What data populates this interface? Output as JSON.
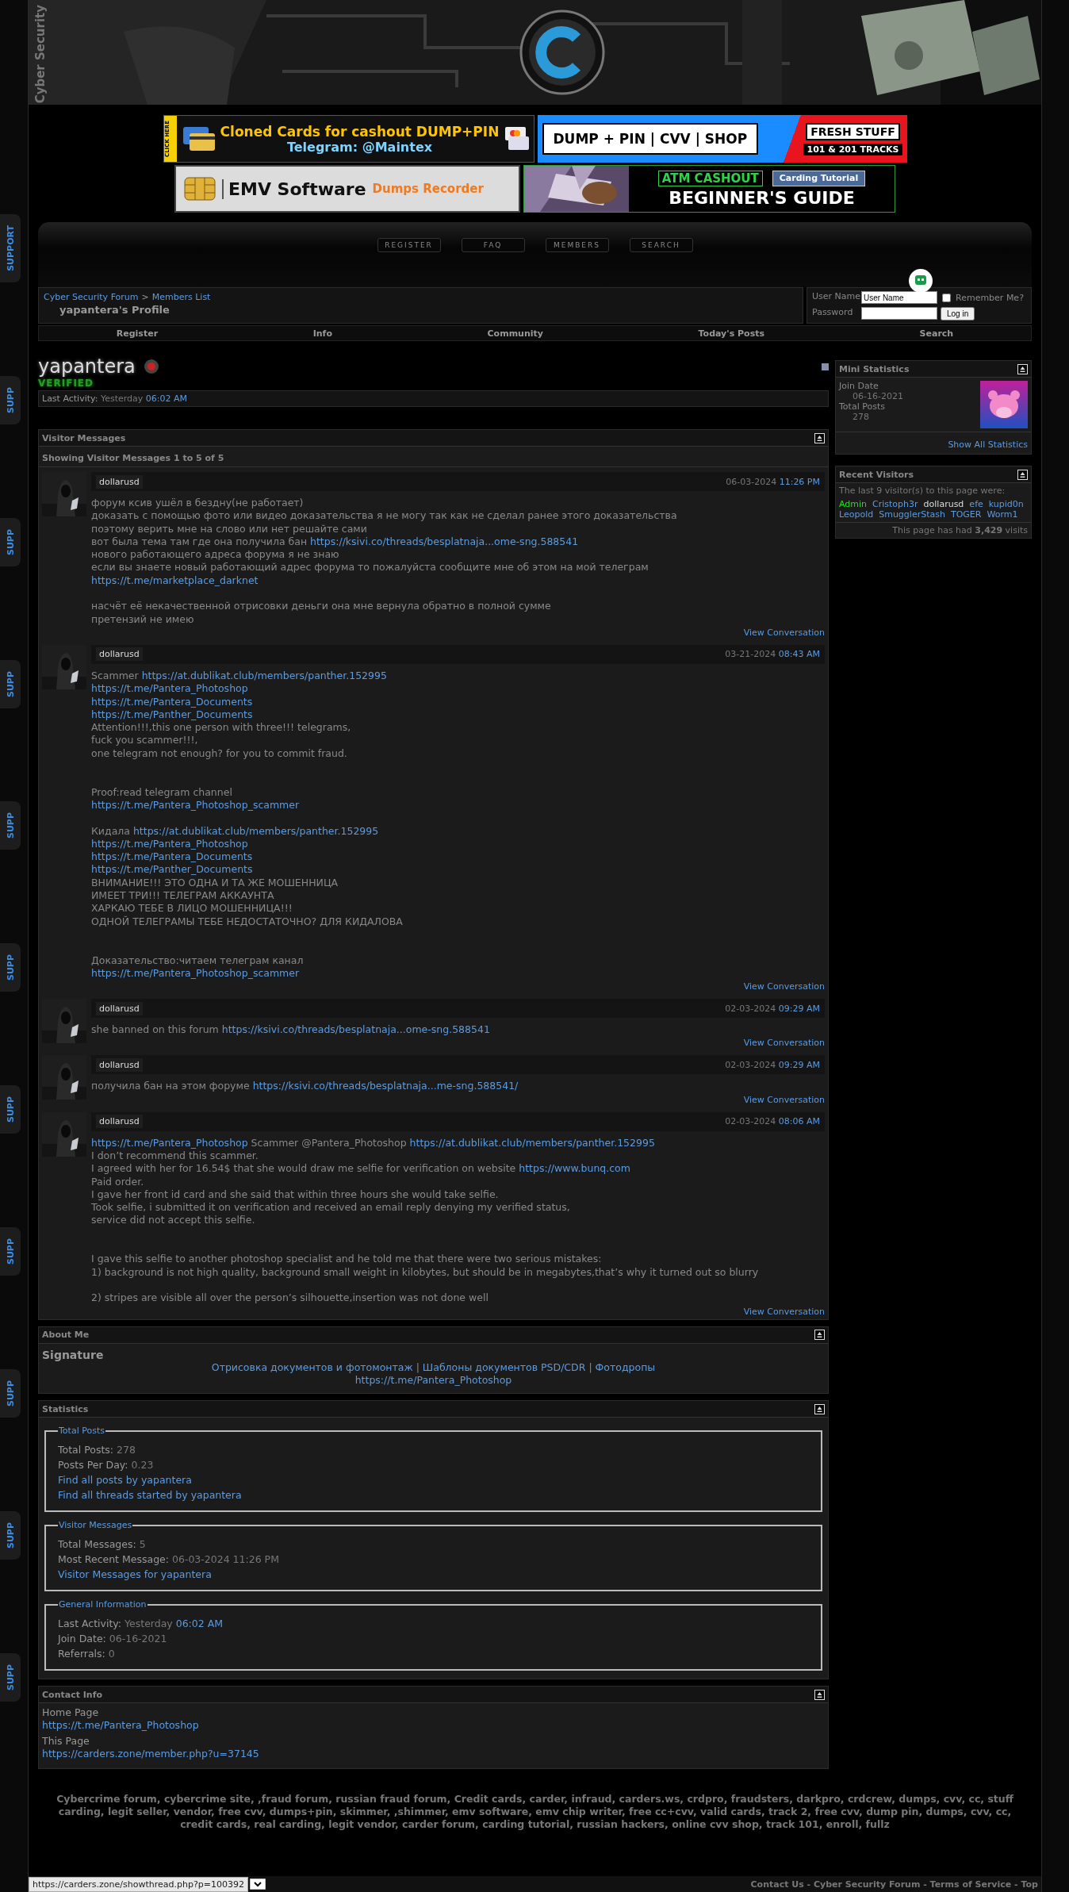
{
  "header": {
    "site_title": "Cyber Security"
  },
  "ad_rows": [
    [
      {
        "kind": "cards",
        "tag": "CLICK HERE",
        "title": "Cloned Cards for cashout DUMP+PIN",
        "contact": "Telegram: @Maintex"
      },
      {
        "kind": "shop",
        "title": "DUMP + PIN | CVV | SHOP",
        "badge": "FRESH STUFF",
        "sub": "101 & 201 TRACKS"
      }
    ],
    [
      {
        "kind": "software",
        "title": "EMV Software",
        "sub": "Dumps Recorder"
      },
      {
        "kind": "tutorial",
        "badge": "ATM CASHOUT",
        "tag": "Carding Tutorial",
        "title": "BEGINNER'S GUIDE"
      }
    ]
  ],
  "nav_buttons": [
    "REGISTER",
    "FAQ",
    "MEMBERS",
    "SEARCH"
  ],
  "breadcrumb": {
    "links": [
      "Cyber Security Forum",
      "Members List"
    ],
    "separator": ">",
    "current": "yapantera's Profile"
  },
  "login": {
    "username_label": "User Name",
    "username_value": "User Name",
    "remember_label": "Remember Me?",
    "remember_checked": false,
    "password_label": "Password",
    "button": "Log in"
  },
  "navbar": [
    "Register",
    "Info",
    "Community",
    "Today's Posts",
    "Search"
  ],
  "profile": {
    "username": "yapantera",
    "online": false,
    "rank": "VERIFIED",
    "last_activity_label": "Last Activity:",
    "last_activity_day": "Yesterday",
    "last_activity_time": "06:02 AM"
  },
  "visitor_messages": {
    "title": "Visitor Messages",
    "subtitle": "Showing Visitor Messages 1 to 5 of 5",
    "messages": [
      {
        "author": "dollarusd",
        "date": "06-03-2024",
        "time": "11:26 PM",
        "action": "View Conversation",
        "lines": [
          {
            "kind": "text",
            "parts": [
              {
                "kind": "plain",
                "text": "форум ксив ушёл в бездну(не работает)"
              }
            ]
          },
          {
            "kind": "text",
            "parts": [
              {
                "kind": "plain",
                "text": "доказать с помощью фото или видео доказательства я не могу так как не сделал ранее этого доказательства"
              }
            ]
          },
          {
            "kind": "text",
            "parts": [
              {
                "kind": "plain",
                "text": "поэтому верить мне на слово или нет решайте сами"
              }
            ]
          },
          {
            "kind": "text",
            "parts": [
              {
                "kind": "plain",
                "text": "вот была тема там где она получила бан "
              },
              {
                "kind": "link",
                "text": "https://ksivi.co/threads/besplatnaja...ome-sng.588541"
              }
            ]
          },
          {
            "kind": "text",
            "parts": [
              {
                "kind": "plain",
                "text": "нового работающего адреса форума я не знаю"
              }
            ]
          },
          {
            "kind": "text",
            "parts": [
              {
                "kind": "plain",
                "text": "если вы знаете новый работающий адрес форума то пожалуйста сообщите мне об этом на мой телеграм"
              }
            ]
          },
          {
            "kind": "text",
            "parts": [
              {
                "kind": "link",
                "text": "https://t.me/marketplace_darknet"
              }
            ]
          },
          {
            "kind": "blank"
          },
          {
            "kind": "text",
            "parts": [
              {
                "kind": "plain",
                "text": "насчёт её некачественной отрисовки деньги она мне вернула обратно в полной сумме"
              }
            ]
          },
          {
            "kind": "text",
            "parts": [
              {
                "kind": "plain",
                "text": "претензий не имею"
              }
            ]
          }
        ]
      },
      {
        "author": "dollarusd",
        "date": "03-21-2024",
        "time": "08:43 AM",
        "action": "View Conversation",
        "lines": [
          {
            "kind": "text",
            "parts": [
              {
                "kind": "plain",
                "text": "Scammer "
              },
              {
                "kind": "link",
                "text": "https://at.dublikat.club/members/panther.152995"
              }
            ]
          },
          {
            "kind": "text",
            "parts": [
              {
                "kind": "link",
                "text": "https://t.me/Pantera_Photoshop"
              }
            ]
          },
          {
            "kind": "text",
            "parts": [
              {
                "kind": "link",
                "text": "https://t.me/Pantera_Documents"
              }
            ]
          },
          {
            "kind": "text",
            "parts": [
              {
                "kind": "link",
                "text": "https://t.me/Panther_Documents"
              }
            ]
          },
          {
            "kind": "text",
            "parts": [
              {
                "kind": "plain",
                "text": "Attention!!!,this one person with three!!! telegrams,"
              }
            ]
          },
          {
            "kind": "text",
            "parts": [
              {
                "kind": "plain",
                "text": "fuck you scammer!!!,"
              }
            ]
          },
          {
            "kind": "text",
            "parts": [
              {
                "kind": "plain",
                "text": "one telegram not enough? for you to commit fraud."
              }
            ]
          },
          {
            "kind": "blank"
          },
          {
            "kind": "blank"
          },
          {
            "kind": "text",
            "parts": [
              {
                "kind": "plain",
                "text": "Proof:read telegram channel"
              }
            ]
          },
          {
            "kind": "text",
            "parts": [
              {
                "kind": "link",
                "text": "https://t.me/Pantera_Photoshop_scammer"
              }
            ]
          },
          {
            "kind": "blank"
          },
          {
            "kind": "text",
            "parts": [
              {
                "kind": "plain",
                "text": "Кидала "
              },
              {
                "kind": "link",
                "text": "https://at.dublikat.club/members/panther.152995"
              }
            ]
          },
          {
            "kind": "text",
            "parts": [
              {
                "kind": "link",
                "text": "https://t.me/Pantera_Photoshop"
              }
            ]
          },
          {
            "kind": "text",
            "parts": [
              {
                "kind": "link",
                "text": "https://t.me/Pantera_Documents"
              }
            ]
          },
          {
            "kind": "text",
            "parts": [
              {
                "kind": "link",
                "text": "https://t.me/Panther_Documents"
              }
            ]
          },
          {
            "kind": "text",
            "parts": [
              {
                "kind": "plain",
                "text": "ВНИМАНИЕ!!! ЭТО ОДНА И ТА ЖЕ МОШЕННИЦА"
              }
            ]
          },
          {
            "kind": "text",
            "parts": [
              {
                "kind": "plain",
                "text": "ИМЕЕТ ТРИ!!! ТЕЛЕГРАМ АККАУНТА"
              }
            ]
          },
          {
            "kind": "text",
            "parts": [
              {
                "kind": "plain",
                "text": "ХАРКАЮ ТЕБЕ В ЛИЦО МОШЕННИЦА!!!"
              }
            ]
          },
          {
            "kind": "text",
            "parts": [
              {
                "kind": "plain",
                "text": "ОДНОЙ ТЕЛЕГРАМЫ ТЕБЕ НЕДОСТАТОЧНО? ДЛЯ КИДАЛОВА"
              }
            ]
          },
          {
            "kind": "blank"
          },
          {
            "kind": "blank"
          },
          {
            "kind": "text",
            "parts": [
              {
                "kind": "plain",
                "text": "Доказательство:читаем телеграм канал"
              }
            ]
          },
          {
            "kind": "text",
            "parts": [
              {
                "kind": "link",
                "text": "https://t.me/Pantera_Photoshop_scammer"
              }
            ]
          }
        ]
      },
      {
        "author": "dollarusd",
        "date": "02-03-2024",
        "time": "09:29 AM",
        "action": "View Conversation",
        "lines": [
          {
            "kind": "text",
            "parts": [
              {
                "kind": "plain",
                "text": "she banned on this forum "
              },
              {
                "kind": "link",
                "text": "https://ksivi.co/threads/besplatnaja...ome-sng.588541"
              }
            ]
          }
        ]
      },
      {
        "author": "dollarusd",
        "date": "02-03-2024",
        "time": "09:29 AM",
        "action": "View Conversation",
        "lines": [
          {
            "kind": "text",
            "parts": [
              {
                "kind": "plain",
                "text": "получила бан на этом форуме "
              },
              {
                "kind": "link",
                "text": "https://ksivi.co/threads/besplatnaja...me-sng.588541/"
              }
            ]
          }
        ]
      },
      {
        "author": "dollarusd",
        "date": "02-03-2024",
        "time": "08:06 AM",
        "action": "View Conversation",
        "lines": [
          {
            "kind": "text",
            "parts": [
              {
                "kind": "link",
                "text": "https://t.me/Pantera_Photoshop"
              },
              {
                "kind": "plain",
                "text": " Scammer @Pantera_Photoshop "
              },
              {
                "kind": "link",
                "text": "https://at.dublikat.club/members/panther.152995"
              }
            ]
          },
          {
            "kind": "text",
            "parts": [
              {
                "kind": "plain",
                "text": "I don’t recommend this scammer."
              }
            ]
          },
          {
            "kind": "text",
            "parts": [
              {
                "kind": "plain",
                "text": "I agreed with her for 16.54$ that she would draw me selfie for verification on website "
              },
              {
                "kind": "link",
                "text": "https://www.bunq.com"
              }
            ]
          },
          {
            "kind": "text",
            "parts": [
              {
                "kind": "plain",
                "text": "Paid order."
              }
            ]
          },
          {
            "kind": "text",
            "parts": [
              {
                "kind": "plain",
                "text": "I gave her front id card and she said that within three hours she would take selfie."
              }
            ]
          },
          {
            "kind": "text",
            "parts": [
              {
                "kind": "plain",
                "text": "Took selfie, i submitted it on verification and received an email reply denying my verified status,"
              }
            ]
          },
          {
            "kind": "text",
            "parts": [
              {
                "kind": "plain",
                "text": "service did not accept this selfie."
              }
            ]
          },
          {
            "kind": "blank"
          },
          {
            "kind": "blank"
          },
          {
            "kind": "text",
            "parts": [
              {
                "kind": "plain",
                "text": "I gave this selfie to another photoshop specialist and he told me that there were two serious mistakes:"
              }
            ]
          },
          {
            "kind": "text",
            "parts": [
              {
                "kind": "plain",
                "text": "1) background is not high quality, background small weight in kilobytes, but should be in megabytes,that’s why it turned out so blurry"
              }
            ]
          },
          {
            "kind": "blank"
          },
          {
            "kind": "text",
            "parts": [
              {
                "kind": "plain",
                "text": "2) stripes are visible all over the person’s silhouette,insertion was not done well"
              }
            ]
          }
        ]
      }
    ]
  },
  "about_me": {
    "title": "About Me",
    "signature_label": "Signature",
    "lines": [
      {
        "kind": "text",
        "parts": [
          {
            "kind": "link",
            "text": "Отрисовка документов и фотомонтаж"
          },
          {
            "kind": "plain",
            "text": " | "
          },
          {
            "kind": "link",
            "text": "Шаблоны документов PSD/CDR"
          },
          {
            "kind": "plain",
            "text": " | "
          },
          {
            "kind": "link",
            "text": "Фотодропы"
          }
        ]
      },
      {
        "kind": "text",
        "parts": [
          {
            "kind": "link",
            "text": "https://t.me/Pantera_Photoshop"
          }
        ]
      }
    ]
  },
  "statistics": {
    "title": "Statistics",
    "groups": [
      {
        "legend": "Total Posts",
        "rows": [
          {
            "kind": "stat",
            "label": "Total Posts:",
            "value": "278"
          },
          {
            "kind": "stat",
            "label": "Posts Per Day:",
            "value": "0.23"
          },
          {
            "kind": "link",
            "text": "Find all posts by yapantera"
          },
          {
            "kind": "link",
            "text": "Find all threads started by yapantera"
          }
        ]
      },
      {
        "legend": "Visitor Messages",
        "rows": [
          {
            "kind": "stat",
            "label": "Total Messages:",
            "value": "5"
          },
          {
            "kind": "stat",
            "label": "Most Recent Message:",
            "value": "06-03-2024 11:26 PM"
          },
          {
            "kind": "link",
            "text": "Visitor Messages for yapantera"
          }
        ]
      },
      {
        "legend": "General Information",
        "rows": [
          {
            "kind": "stat",
            "label": "Last Activity:",
            "value": "Yesterday",
            "time": "06:02 AM"
          },
          {
            "kind": "stat",
            "label": "Join Date:",
            "value": "06-16-2021"
          },
          {
            "kind": "stat",
            "label": "Referrals:",
            "value": "0"
          }
        ]
      }
    ]
  },
  "contact_info": {
    "title": "Contact Info",
    "items": [
      {
        "label": "Home Page",
        "link": "https://t.me/Pantera_Photoshop"
      },
      {
        "label": "This Page",
        "link": "https://carders.zone/member.php?u=37145"
      }
    ]
  },
  "sidebar": {
    "mini_statistics": {
      "title": "Mini Statistics",
      "rows": [
        {
          "label": "Join Date",
          "value": "06-16-2021"
        },
        {
          "label": "Total Posts",
          "value": "278"
        }
      ],
      "link": "Show All Statistics"
    },
    "recent_visitors": {
      "title": "Recent Visitors",
      "intro": "The last 9 visitor(s) to this page were:",
      "visitors": [
        {
          "name": "Admin",
          "color": "#22dd22"
        },
        {
          "name": "Cristoph3r",
          "color": "#5b9be0"
        },
        {
          "name": "dollarusd",
          "color": "#dddddd"
        },
        {
          "name": "efe",
          "color": "#5b9be0"
        },
        {
          "name": "kupid0n",
          "color": "#5b9be0"
        },
        {
          "name": "Leopold",
          "color": "#5b9be0"
        },
        {
          "name": "SmugglerStash",
          "color": "#5b9be0"
        },
        {
          "name": "TOGER",
          "color": "#5b9be0"
        },
        {
          "name": "Worm1",
          "color": "#5b9be0"
        }
      ],
      "visits": "This page has had **3,429** visits"
    }
  },
  "side_tabs": [
    "SUPPORT",
    "SUPP",
    "SUPP",
    "SUPP",
    "SUPP",
    "SUPP",
    "SUPP",
    "SUPP",
    "SUPP",
    "SUPP",
    "SUPP"
  ],
  "footer": {
    "keywords": "Cybercrime forum, cybercrime site, ,fraud forum, russian fraud forum, Credit cards, carder, infraud, carders.ws, crdpro, fraudsters, darkpro, crdcrew, dumps, cvv, cc, stuff carding, legit seller, vendor, free cvv, dumps+pin, skimmer, ,shimmer, emv software, emv chip writer, free cc+cvv, valid cards, track 2, free cvv, dump pin, dumps, cvv, cc, credit cards, real carding, legit vendor, carder forum, carding tutorial, russian hackers, online cvv shop, track 101, enroll, fullz",
    "links": [
      "Contact Us",
      "Cyber Security Forum",
      "Terms of Service",
      "Top"
    ],
    "separators": [
      " - ",
      " - ",
      " - "
    ]
  },
  "status_bar": {
    "url": "https://carders.zone/showthread.php?p=100392"
  }
}
